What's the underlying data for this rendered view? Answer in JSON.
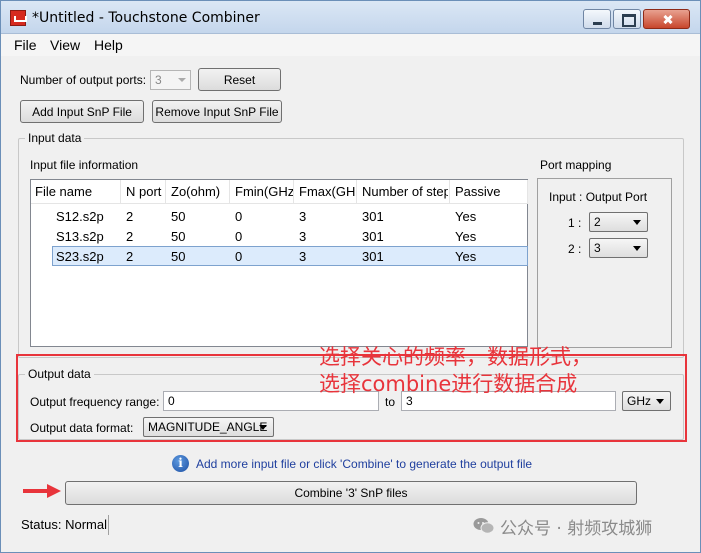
{
  "window": {
    "title": "*Untitled - Touchstone Combiner"
  },
  "menu": [
    "File",
    "View",
    "Help"
  ],
  "controls": {
    "num_ports_label": "Number of output ports:",
    "num_ports_value": "3",
    "reset_label": "Reset",
    "add_label": "Add Input SnP File",
    "remove_label": "Remove Input SnP File"
  },
  "input_data": {
    "group_title": "Input data",
    "file_info_title": "Input file information",
    "columns": [
      "File name",
      "N port",
      "Zo(ohm)",
      "Fmin(GHz",
      "Fmax(GHz",
      "Number of steps",
      "Passive"
    ],
    "rows": [
      [
        "S12.s2p",
        "2",
        "50",
        "0",
        "3",
        "301",
        "Yes"
      ],
      [
        "S13.s2p",
        "2",
        "50",
        "0",
        "3",
        "301",
        "Yes"
      ],
      [
        "S23.s2p",
        "2",
        "50",
        "0",
        "3",
        "301",
        "Yes"
      ]
    ],
    "selected_row": 2
  },
  "port_mapping": {
    "title": "Port mapping",
    "header": "Input :  Output Port",
    "rows": [
      {
        "input": "1 :",
        "output": "2"
      },
      {
        "input": "2 :",
        "output": "3"
      }
    ]
  },
  "output_data": {
    "group_title": "Output data",
    "freq_label": "Output frequency range:",
    "freq_from": "0",
    "to_label": "to",
    "freq_to": "3",
    "unit": "GHz",
    "format_label": "Output data format:",
    "format_value": "MAGNITUDE_ANGLE"
  },
  "annotation": {
    "line1": "选择关心的频率，数据形式，",
    "line2": "选择combine进行数据合成",
    "color": "#e8343b"
  },
  "info": {
    "icon": "info-icon",
    "text": "Add more input file or click 'Combine' to generate the output file"
  },
  "combine_label": "Combine '3' SnP files",
  "status": "Status: Normal",
  "watermark": "公众号 · 射频攻城狮"
}
